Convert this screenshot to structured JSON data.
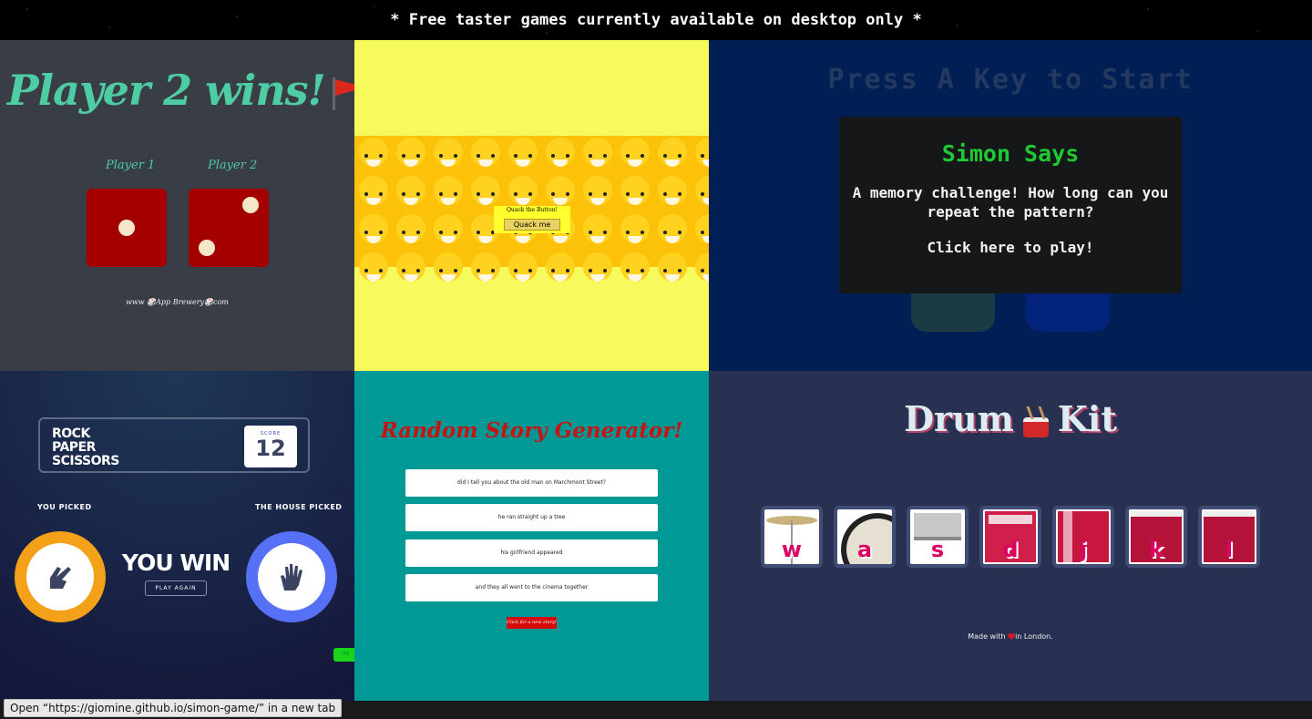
{
  "banner": {
    "text": "* Free taster games currently available on desktop only *"
  },
  "dice": {
    "title": "Player 2 wins!",
    "player1": "Player 1",
    "player2": "Player 2",
    "die1_value": 1,
    "die2_value": 2,
    "footer": "www 🎲App Brewery🎲com"
  },
  "duck": {
    "label": "Quack the Button!",
    "button": "Quack me"
  },
  "simon": {
    "press": "Press A Key to Start",
    "heading": "Simon Says",
    "description": "A memory challenge! How long can you repeat the pattern?",
    "cta": "Click here to play!"
  },
  "rps": {
    "title_line1": "ROCK",
    "title_line2": "PAPER",
    "title_line3": "SCISSORS",
    "score_label": "SCORE",
    "score": "12",
    "you_picked": "YOU PICKED",
    "house_picked": "THE HOUSE PICKED",
    "result": "YOU WIN",
    "play_again": "PLAY AGAIN",
    "rules": "RE"
  },
  "story": {
    "title": "Random Story Generator!",
    "lines": [
      "did I tell you about the old man on Marchmont Street?",
      "he ran straight up a tree",
      "his girlfriend appeared",
      "and they all went to the cinema together"
    ],
    "button": "Click for a new story!"
  },
  "drum": {
    "title_part1": "Drum",
    "title_part2": "Kit",
    "keys": [
      "w",
      "a",
      "s",
      "d",
      "j",
      "k",
      "l"
    ],
    "footer_pre": "Made with",
    "footer_post": "in London."
  },
  "statusbar": {
    "text": "Open “https://giomine.github.io/simon-game/” in a new tab"
  },
  "colors": {
    "dice_bg": "#393e46",
    "dice_accent": "#4ecca3",
    "duck_bg": "#f7fa5c",
    "simon_bg": "#011f55",
    "simon_green": "#1ec933",
    "story_bg": "#009995",
    "story_red": "#c41414",
    "drum_bg": "#283152",
    "drum_key": "#da0463"
  }
}
